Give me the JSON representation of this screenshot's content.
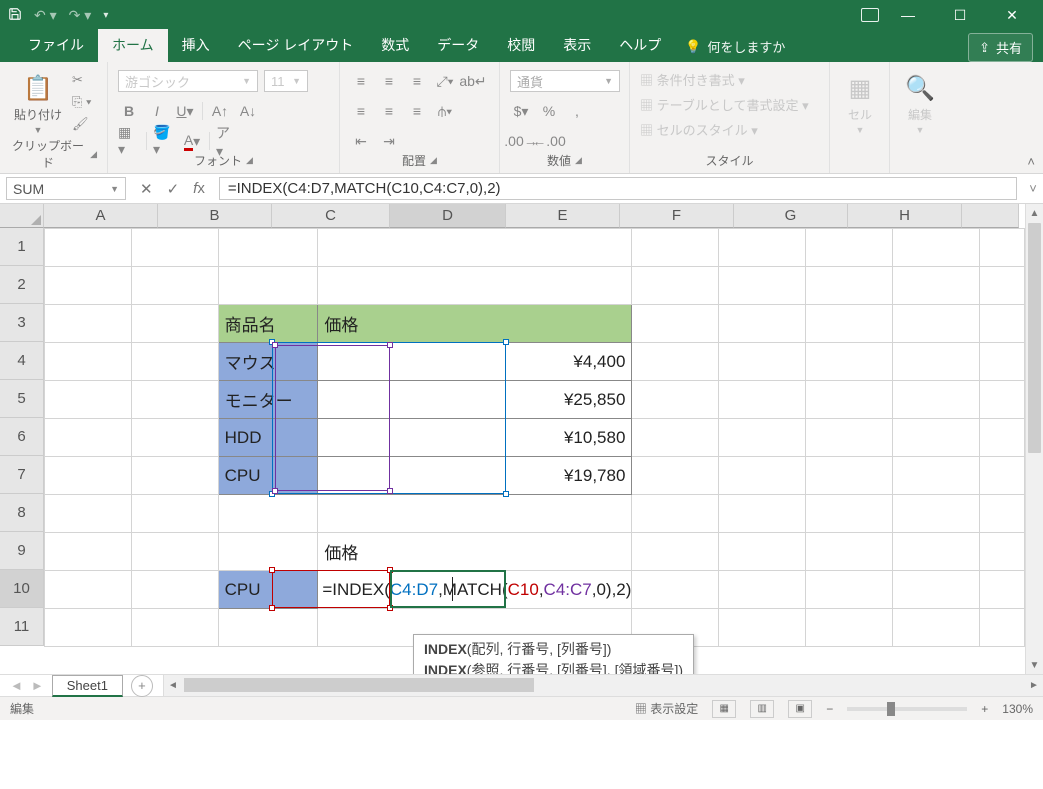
{
  "titlebar": {
    "save_icon": "💾"
  },
  "tabs": {
    "file": "ファイル",
    "home": "ホーム",
    "insert": "挿入",
    "pagelayout": "ページ レイアウト",
    "formulas": "数式",
    "data": "データ",
    "review": "校閲",
    "view": "表示",
    "help": "ヘルプ",
    "tellme": "何をしますか",
    "share": "共有"
  },
  "ribbon": {
    "clipboard": {
      "paste": "貼り付け",
      "label": "クリップボード"
    },
    "font": {
      "name": "游ゴシック",
      "size": "11",
      "label": "フォント"
    },
    "align": {
      "label": "配置"
    },
    "number": {
      "format": "通貨",
      "label": "数値"
    },
    "styles": {
      "cond": "条件付き書式",
      "table": "テーブルとして書式設定",
      "cell": "セルのスタイル",
      "label": "スタイル"
    },
    "cells": {
      "label": "セル"
    },
    "editing": {
      "label": "編集"
    }
  },
  "fbar": {
    "name": "SUM",
    "formula": "=INDEX(C4:D7,MATCH(C10,C4:C7,0),2)"
  },
  "columns": [
    "A",
    "B",
    "C",
    "D",
    "E",
    "F",
    "G",
    "H"
  ],
  "rows": [
    "1",
    "2",
    "3",
    "4",
    "5",
    "6",
    "7",
    "8",
    "9",
    "10",
    "11"
  ],
  "cells": {
    "C3": "商品名",
    "D3": "価格",
    "C4": "マウス",
    "D4": "¥4,400",
    "C5": "モニター",
    "D5": "¥25,850",
    "C6": "HDD",
    "D6": "¥10,580",
    "C7": "CPU",
    "D7": "¥19,780",
    "D9": "価格",
    "C10": "CPU"
  },
  "d10_formula": {
    "pre": "=INDEX(",
    "r1": "C4:D7",
    "m1": ",MATCH(",
    "r2": "C10",
    "c1": ",",
    "r3": "C4:C7",
    "m2": ",0),2)"
  },
  "tooltip": {
    "line1a": "INDEX",
    "line1b": "(配列, 行番号, [列番号])",
    "line2a": "INDEX",
    "line2b": "(参照, 行番号, [列番号], [領域番号])"
  },
  "sheets": {
    "s1": "Sheet1",
    "navprev": "◄",
    "navnext": "►"
  },
  "status": {
    "mode": "編集",
    "disp": "表示設定",
    "zoom": "130%"
  }
}
